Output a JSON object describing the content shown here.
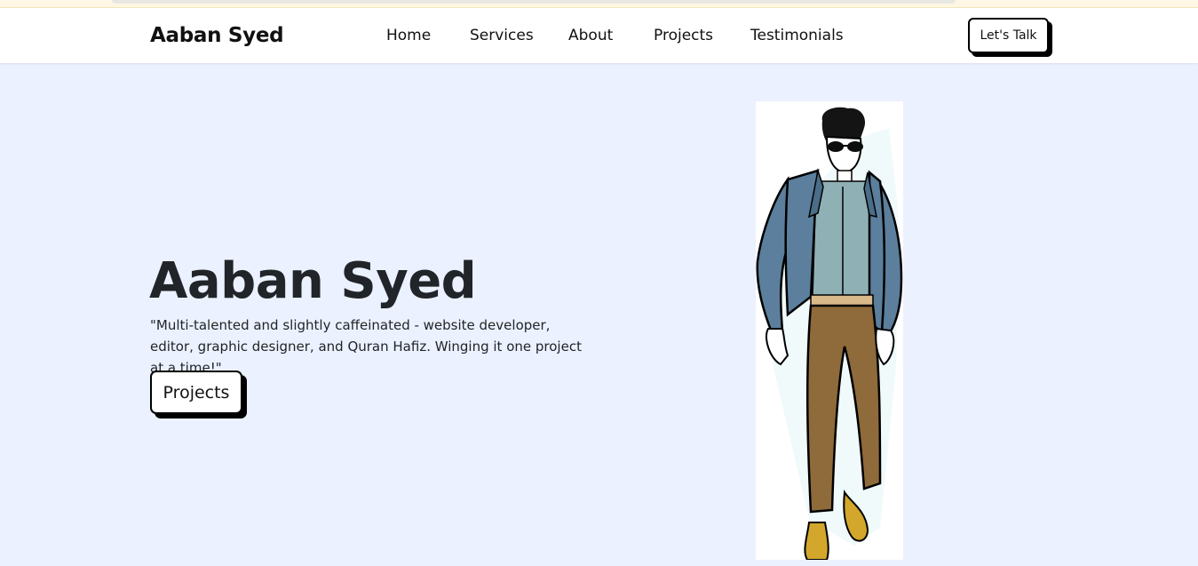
{
  "header": {
    "brand": "Aaban Syed",
    "nav": [
      {
        "label": "Home"
      },
      {
        "label": "Services"
      },
      {
        "label": "About"
      },
      {
        "label": "Projects"
      },
      {
        "label": "Testimonials"
      }
    ],
    "cta_label": "Let's Talk"
  },
  "hero": {
    "title": "Aaban Syed",
    "tagline": "\"Multi-talented and slightly caffeinated - website developer, editor, graphic designer, and Quran Hafiz. Winging it one project at a time!\"",
    "button_label": "Projects",
    "illustration": "man-in-blue-blazer-illustration"
  },
  "colors": {
    "page_bg": "#ebf1fe",
    "blazer": "#5b7f9c",
    "shirt": "#8fb1b5",
    "trousers": "#8f6a3a",
    "shoes": "#d2a72c"
  }
}
